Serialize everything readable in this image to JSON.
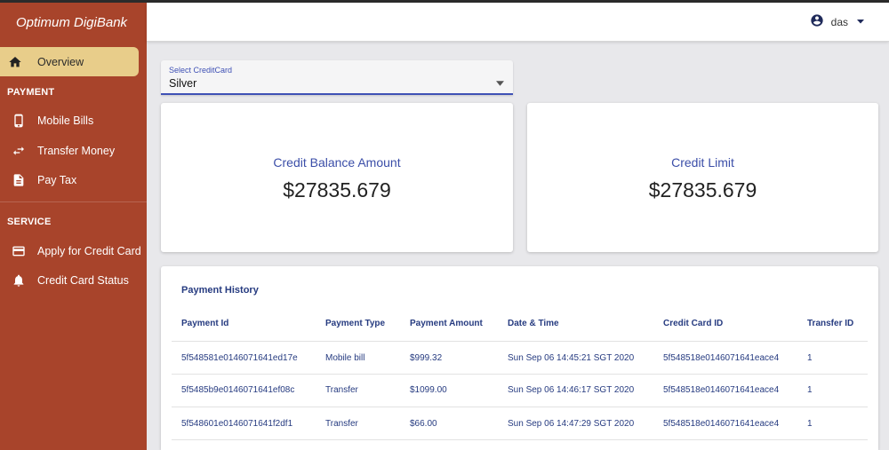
{
  "app": {
    "brand": "Optimum DigiBank"
  },
  "sidebar": {
    "overview": {
      "label": "Overview",
      "icon": "home-icon"
    },
    "payment_section": "PAYMENT",
    "payment_items": [
      {
        "label": "Mobile Bills",
        "icon": "mobile-phone-icon"
      },
      {
        "label": "Transfer Money",
        "icon": "transfer-arrows-icon"
      },
      {
        "label": "Pay Tax",
        "icon": "document-icon"
      }
    ],
    "service_section": "SERVICE",
    "service_items": [
      {
        "label": "Apply for Credit Card",
        "icon": "credit-card-icon"
      },
      {
        "label": "Credit Card Status",
        "icon": "bell-icon"
      }
    ]
  },
  "header": {
    "username": "das",
    "icon": "account-circle-icon"
  },
  "credit_card_select": {
    "label": "Select CreditCard",
    "value": "Silver"
  },
  "cards": {
    "balance": {
      "title": "Credit Balance Amount",
      "value": "$27835.679"
    },
    "limit": {
      "title": "Credit Limit",
      "value": "$27835.679"
    }
  },
  "payment_history": {
    "title": "Payment History",
    "columns": [
      "Payment Id",
      "Payment Type",
      "Payment Amount",
      "Date & Time",
      "Credit Card ID",
      "Transfer ID"
    ],
    "rows": [
      [
        "5f548581e0146071641ed17e",
        "Mobile bill",
        "$999.32",
        "Sun Sep 06 14:45:21 SGT 2020",
        "5f548518e0146071641eace4",
        "1"
      ],
      [
        "5f5485b9e0146071641ef08c",
        "Transfer",
        "$1099.00",
        "Sun Sep 06 14:46:17 SGT 2020",
        "5f548518e0146071641eace4",
        "1"
      ],
      [
        "5f548601e0146071641f2df1",
        "Transfer",
        "$66.00",
        "Sun Sep 06 14:47:29 SGT 2020",
        "5f548518e0146071641eace4",
        "1"
      ]
    ]
  },
  "colors": {
    "sidebar": "#a8442b",
    "active_nav": "#e8cd8a",
    "accent": "#3f51b5",
    "table_text": "#263b80"
  }
}
